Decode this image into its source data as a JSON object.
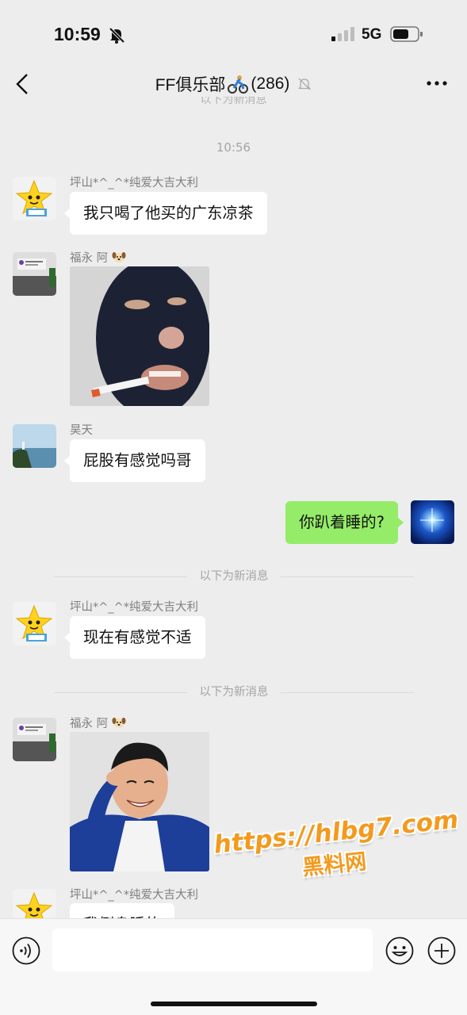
{
  "status_bar": {
    "time": "10:59",
    "network": "5G"
  },
  "header": {
    "title": "FF俱乐部",
    "member_count": "(286)"
  },
  "partial_divider_text": "以下为新消息",
  "timestamp": "10:56",
  "messages": [
    {
      "sender": "坪山*^_^*纯爱大吉大利",
      "text": "我只喝了他买的广东凉茶"
    },
    {
      "sender": "福永 阿"
    },
    {
      "sender": "昊天",
      "text": "屁股有感觉吗哥"
    },
    {
      "text": "你趴着睡的?"
    },
    {
      "sender": "坪山*^_^*纯爱大吉大利",
      "text": "现在有感觉不适"
    },
    {
      "sender": "福永 阿"
    },
    {
      "sender": "坪山*^_^*纯爱大吉大利",
      "text": "我侧身睡的"
    }
  ],
  "divider_text": "以下为新消息",
  "watermark": {
    "url": "https://hlbg7.com",
    "name": "黑料网"
  },
  "colors": {
    "background": "#ededed",
    "own_bubble": "#95ec69",
    "other_bubble": "#ffffff"
  }
}
